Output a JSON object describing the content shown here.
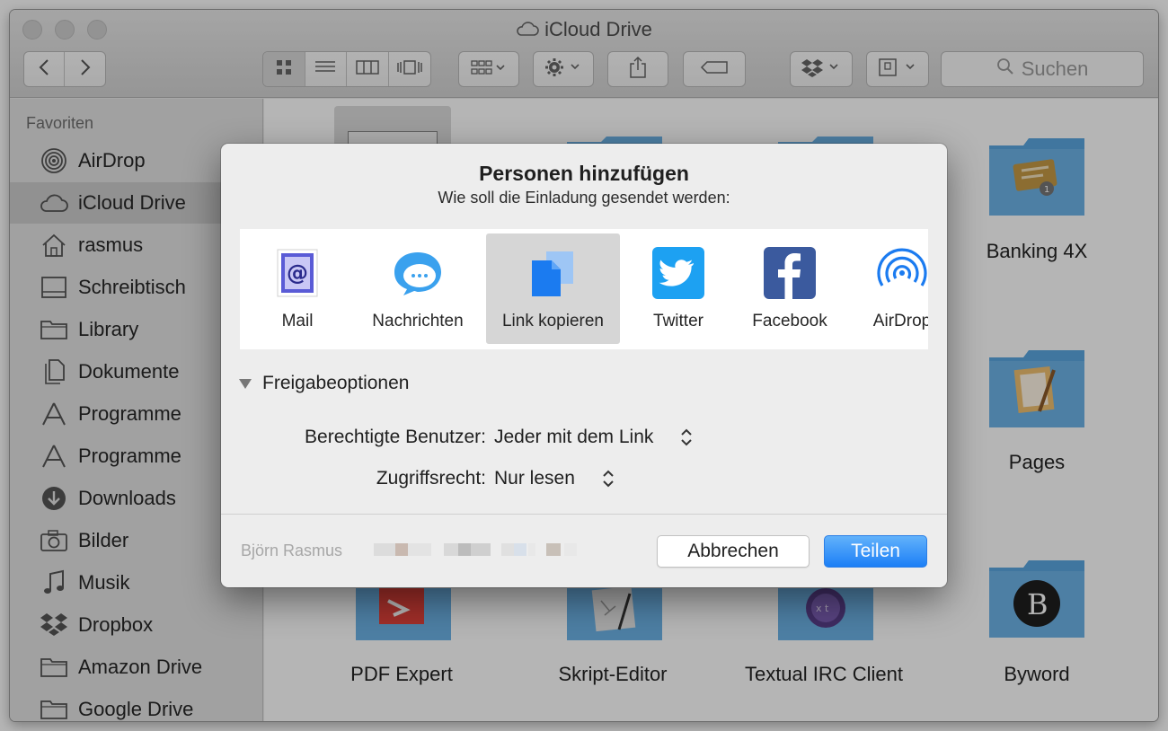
{
  "window": {
    "title": "iCloud Drive"
  },
  "toolbar": {
    "search_placeholder": "Suchen",
    "back_icon": "chevron-left-icon",
    "forward_icon": "chevron-right-icon"
  },
  "sidebar": {
    "heading": "Favoriten",
    "items": [
      {
        "label": "AirDrop",
        "icon": "airdrop-icon"
      },
      {
        "label": "iCloud Drive",
        "icon": "cloud-icon",
        "selected": true
      },
      {
        "label": "rasmus",
        "icon": "home-icon"
      },
      {
        "label": "Schreibtisch",
        "icon": "desktop-icon"
      },
      {
        "label": "Library",
        "icon": "folder-icon"
      },
      {
        "label": "Dokumente",
        "icon": "documents-icon"
      },
      {
        "label": "Programme",
        "icon": "apps-icon"
      },
      {
        "label": "Programme",
        "icon": "apps-icon"
      },
      {
        "label": "Downloads",
        "icon": "download-icon"
      },
      {
        "label": "Bilder",
        "icon": "camera-icon"
      },
      {
        "label": "Musik",
        "icon": "music-icon"
      },
      {
        "label": "Dropbox",
        "icon": "dropbox-icon"
      },
      {
        "label": "Amazon Drive",
        "icon": "folder-icon"
      },
      {
        "label": "Google Drive",
        "icon": "folder-icon"
      }
    ]
  },
  "content": {
    "folders": [
      {
        "name": "Banking 4X"
      },
      {
        "name": "Pages"
      },
      {
        "name": "PDF Expert"
      },
      {
        "name": "Skript-Editor"
      },
      {
        "name": "Textual IRC Client"
      },
      {
        "name": "Byword"
      }
    ]
  },
  "dialog": {
    "title": "Personen hinzufügen",
    "subtitle": "Wie soll die Einladung gesendet werden:",
    "services": [
      {
        "label": "Mail",
        "icon": "mail-icon"
      },
      {
        "label": "Nachrichten",
        "icon": "messages-icon"
      },
      {
        "label": "Link kopieren",
        "icon": "copy-link-icon",
        "selected": true
      },
      {
        "label": "Twitter",
        "icon": "twitter-icon"
      },
      {
        "label": "Facebook",
        "icon": "facebook-icon"
      },
      {
        "label": "AirDrop",
        "icon": "airdrop-icon"
      }
    ],
    "options_heading": "Freigabeoptionen",
    "permitted_users_label": "Berechtigte Benutzer:",
    "permitted_users_value": "Jeder mit dem Link",
    "access_label": "Zugriffsrecht:",
    "access_value": "Nur lesen",
    "owner_name": "Björn Rasmus",
    "cancel_label": "Abbrechen",
    "share_label": "Teilen"
  },
  "colors": {
    "accent": "#1c7ff6",
    "folder": "#6db3e8"
  }
}
